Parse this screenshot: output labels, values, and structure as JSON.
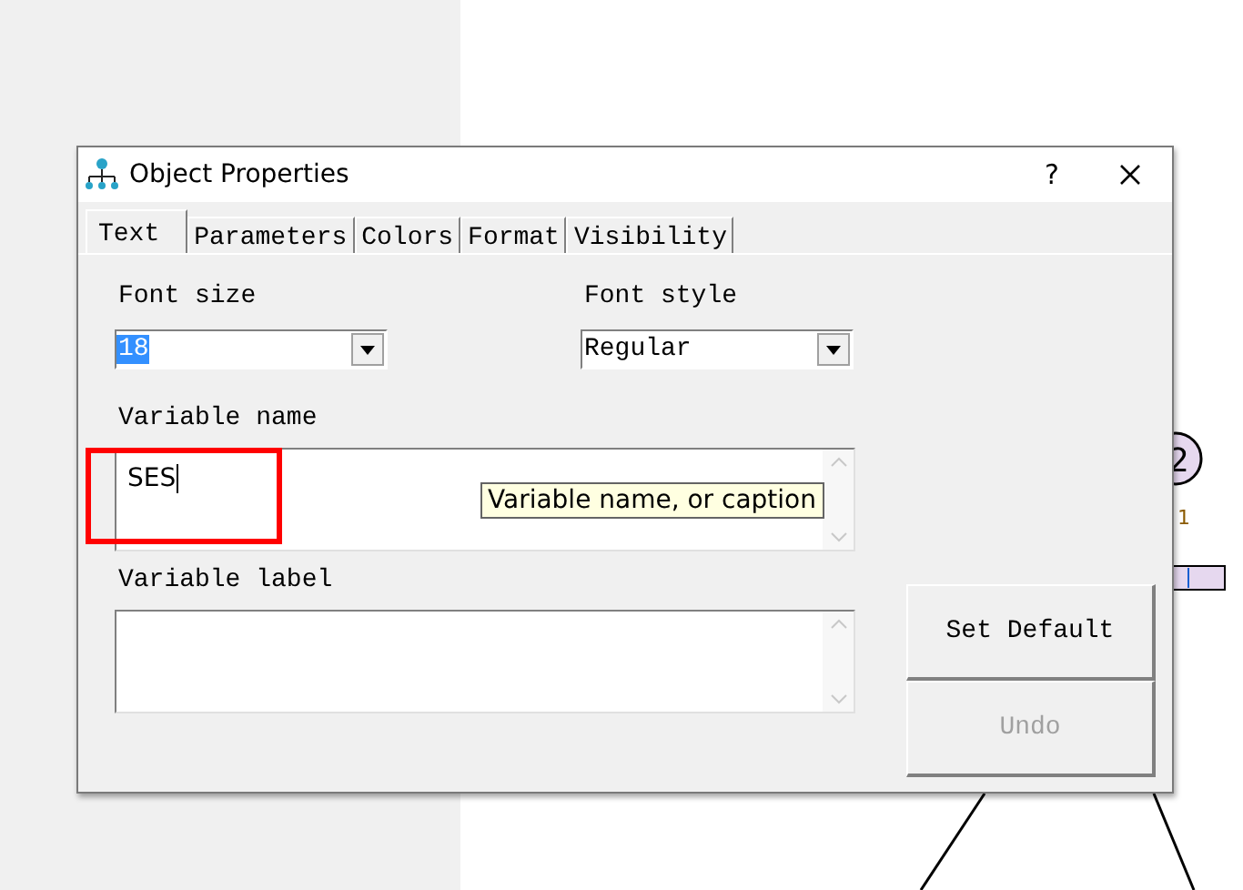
{
  "diagram": {
    "circle_node": {
      "label": "2"
    },
    "path_label": "1"
  },
  "dialog": {
    "title": "Object Properties",
    "help": "?",
    "tabs": [
      {
        "label": "Text",
        "selected": true
      },
      {
        "label": "Parameters",
        "selected": false
      },
      {
        "label": "Colors",
        "selected": false
      },
      {
        "label": "Format",
        "selected": false
      },
      {
        "label": "Visibility",
        "selected": false
      }
    ],
    "font_size": {
      "label": "Font size",
      "value": "18",
      "text_selected": true
    },
    "font_style": {
      "label": "Font style",
      "value": "Regular"
    },
    "variable_name": {
      "label": "Variable name",
      "value": "SES",
      "focused": true,
      "highlighted": true
    },
    "tooltip": "Variable name, or caption",
    "variable_label": {
      "label": "Variable label"
    },
    "buttons": [
      {
        "label": "Set Default",
        "disabled": false
      },
      {
        "label": "Undo",
        "disabled": true
      }
    ]
  }
}
